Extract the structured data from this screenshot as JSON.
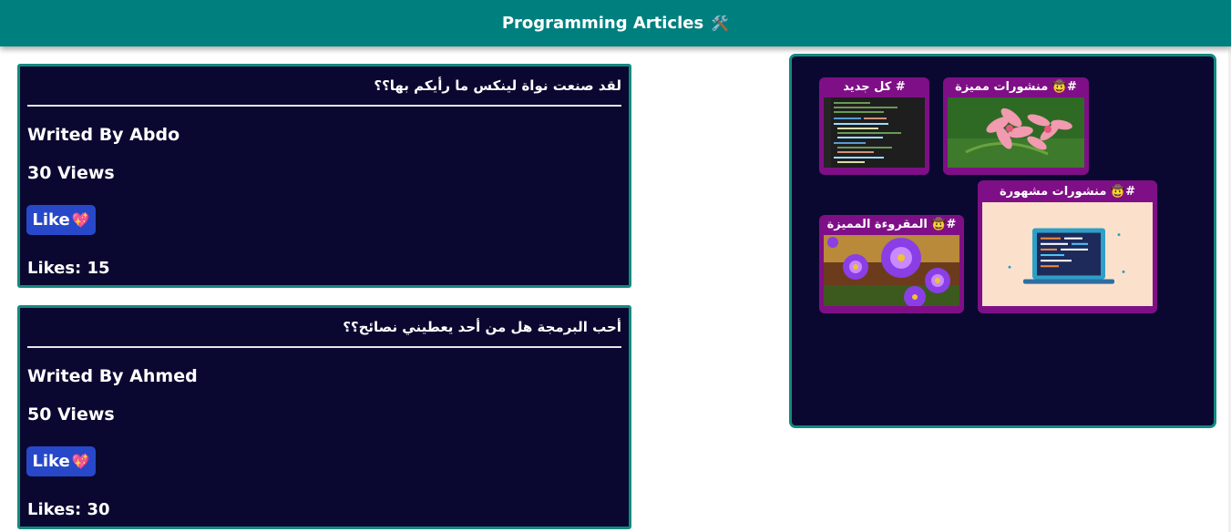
{
  "header": {
    "title": "Programming Articles",
    "tools_icon": "🛠️",
    "bg_color": "#007f7f"
  },
  "articles": [
    {
      "title": "لقد صنعت نواة لينكس ما رأيكم بها؟؟",
      "author": "Writed By Abdo",
      "views": "30 Views",
      "like_label": "Like",
      "like_icon": "💖",
      "likes": "Likes: 15"
    },
    {
      "title": "أحب البرمجة هل من أحد يعطيني نصائح؟؟",
      "author": "Writed By Ahmed",
      "views": "50 Views",
      "like_label": "Like",
      "like_icon": "💖",
      "likes": "Likes: 30"
    }
  ],
  "categories": [
    {
      "label": "# كل جديد",
      "thumb": "code-editor-image"
    },
    {
      "label": "#🤠 منشورات مميزة",
      "thumb": "pink-flowers-image"
    },
    {
      "label": "#🤠 منشورات مشهورة",
      "thumb": "laptop-code-image"
    },
    {
      "label": "#🤠 المقروءة المميزة",
      "thumb": "purple-flowers-image"
    }
  ],
  "colors": {
    "card_bg": "#0a0830",
    "card_border": "#138a80",
    "like_button": "#2748c9",
    "category_card": "#7f0f86"
  }
}
